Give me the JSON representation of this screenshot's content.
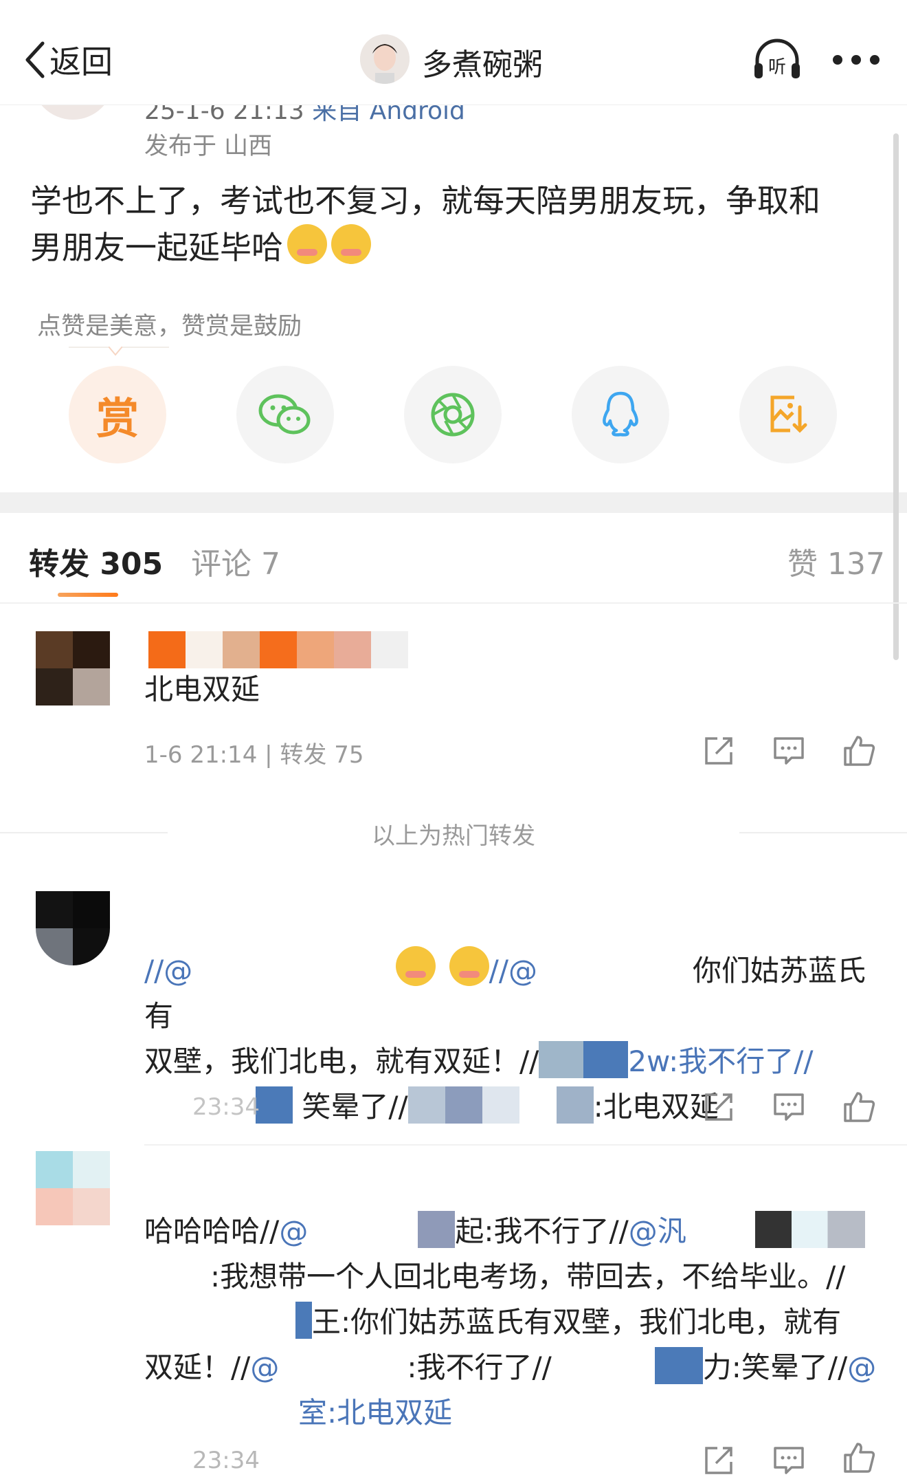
{
  "header": {
    "back_label": "返回",
    "user_name": "多煮碗粥",
    "listen_label": "听"
  },
  "post": {
    "meta_time": "25-1-6 21:13",
    "meta_source": "来自 Android",
    "publish_location": "发布于 山西",
    "text_line1": "学也不上了，考试也不复习，就每天陪男朋友玩，争取和",
    "text_line2": "男朋友一起延毕哈",
    "emoji_names": [
      "blushing-emoji",
      "blushing-emoji"
    ]
  },
  "reward_tip": "点赞是美意，赞赏是鼓励",
  "share": {
    "reward_glyph": "赏",
    "icons": [
      "reward-icon",
      "wechat-icon",
      "moments-icon",
      "qq-icon",
      "save-image-icon"
    ]
  },
  "tabs": {
    "forward_label": "转发 305",
    "comment_label": "评论 7",
    "like_label": "赞 137"
  },
  "hot_forward": {
    "text": "北电双延",
    "meta": "1-6 21:14 | 转发 75"
  },
  "section_label": "以上为热门转发",
  "forwards": [
    {
      "line1_prefix": "//@",
      "line1_after_emoji": "//@",
      "line1_tail": "你们姑苏蓝氏有",
      "line2": "双壁，我们北电，就有双延！//",
      "line2_tail": "2w:我不行了//",
      "line3_a": "笑晕了//",
      "line3_b": ":北电双延",
      "time": "23:34"
    },
    {
      "line1_a": "哈哈哈哈//",
      "line1_mention": "@",
      "line1_b": "起:我不行了//",
      "line1_mention2": "@汎",
      "line2": ":我想带一个人回北电考场，带回去，不给毕业。//",
      "line3": "王:你们姑苏蓝氏有双壁，我们北电，就有",
      "line4_a": "双延！//",
      "line4_mention": "@",
      "line4_b": ":我不行了//",
      "line4_c": "力:笑晕了//",
      "line4_mention2": "@",
      "line5": "室:北电双延",
      "time": "23:34"
    }
  ],
  "colors": {
    "accent_orange": "#ff7a1a",
    "mention_blue": "#4a75b8",
    "wechat_green": "#5ec25c",
    "qq_blue": "#3ea6f0",
    "save_orange": "#f4a62a"
  }
}
